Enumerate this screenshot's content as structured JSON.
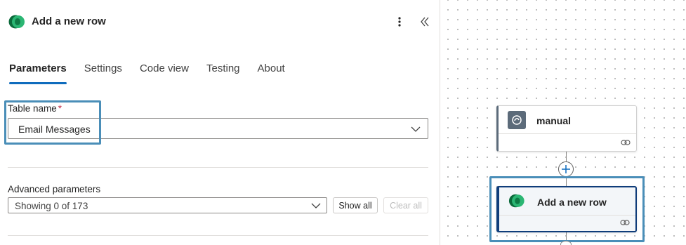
{
  "panel": {
    "title": "Add a new row",
    "tabs": [
      {
        "label": "Parameters",
        "active": true
      },
      {
        "label": "Settings",
        "active": false
      },
      {
        "label": "Code view",
        "active": false
      },
      {
        "label": "Testing",
        "active": false
      },
      {
        "label": "About",
        "active": false
      }
    ],
    "table_name": {
      "label": "Table name",
      "required_mark": "*",
      "value": "Email Messages"
    },
    "advanced": {
      "label": "Advanced parameters",
      "value": "Showing 0 of 173",
      "show_all_label": "Show all",
      "clear_all_label": "Clear all"
    }
  },
  "canvas": {
    "nodes": [
      {
        "title": "manual",
        "icon": "manual-trigger-icon"
      },
      {
        "title": "Add a new row",
        "icon": "dataverse-icon"
      }
    ]
  },
  "colors": {
    "accent": "#0f6cbd",
    "highlight": "#4a8eb8",
    "required": "#c4314b",
    "node_selected": "#0f3d7a"
  }
}
